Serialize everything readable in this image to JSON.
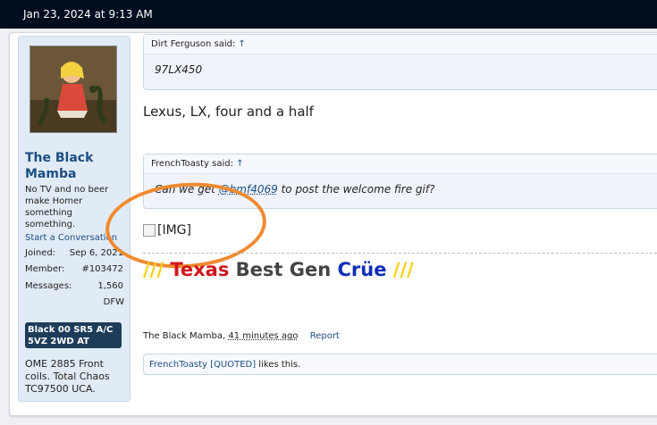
{
  "topbar": {
    "date": "Jan 23, 2024 at 9:13 AM"
  },
  "user": {
    "name": "The Black Mamba",
    "title": "No TV and no beer make Homer something something.",
    "start_conversation": "Start a Conversation",
    "stats": [
      {
        "label": "Joined:",
        "value": "Sep 6, 2021"
      },
      {
        "label": "Member:",
        "value": "#103472"
      },
      {
        "label": "Messages:",
        "value": "1,560"
      }
    ],
    "location": "DFW",
    "vehicle_badge": "Black 00 SR5 A/C 5VZ 2WD AT",
    "description": "OME 2885 Front coils. Total Chaos TC97500 UCA."
  },
  "quote1": {
    "author": "Dirt Ferguson said:",
    "arrow": "↑",
    "text": "97LX450"
  },
  "message": "Lexus, LX, four and a half",
  "quote2": {
    "author": "FrenchToasty said:",
    "arrow": "↑",
    "text_before": "Can we get ",
    "mention": "@bmf4069",
    "text_after": " to post the welcome fire gif?"
  },
  "image_placeholder": "[IMG]",
  "signature": {
    "slashes_left": "///",
    "texas": "Texas",
    "best": "Best",
    "gen": "Gen",
    "crue": "Crüe",
    "slashes_right": "///",
    "colors": {
      "yellow": "#f7d117",
      "red": "#d0161b",
      "blue": "#0d2eb8",
      "gray": "#444444"
    }
  },
  "meta": {
    "author": "The Black Mamba,",
    "time": "41 minutes ago",
    "report": "Report"
  },
  "likes": {
    "user": "FrenchToasty [QUOTED]",
    "suffix": " likes this."
  }
}
